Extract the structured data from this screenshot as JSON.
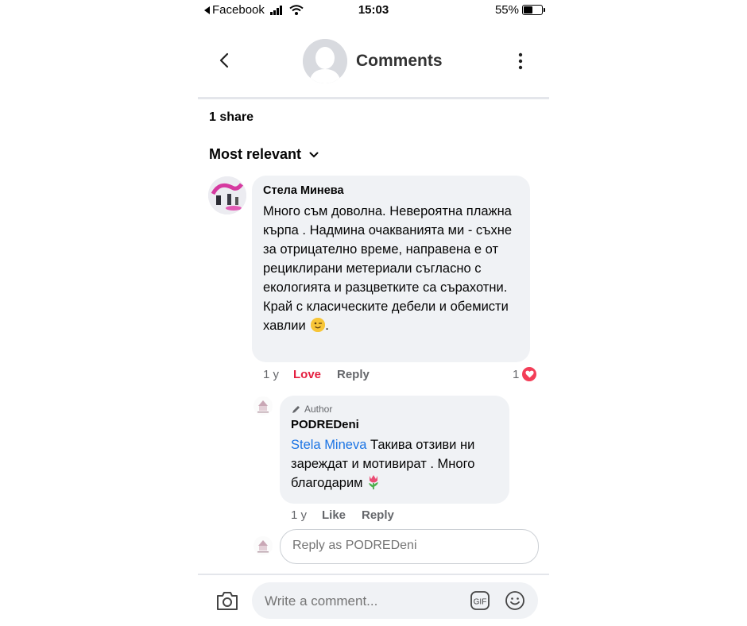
{
  "status_bar": {
    "back_app": "Facebook",
    "time": "15:03",
    "battery_percent": "55%",
    "battery_level": 0.55
  },
  "header": {
    "title": "Comments"
  },
  "post": {
    "shares": "1 share",
    "sort_label": "Most relevant"
  },
  "comment": {
    "author": "Стела Минева",
    "text": "Много съм доволна. Невероятна плажна кърпа . Надмина очакванията ми - съхне за отрицателно време, направена е от рециклирани метериали съгласно с екологията и разцветките са сърахотни. Край с класическите дебели и обемисти хавлии",
    "text_end": ".",
    "time": "1 y",
    "love_label": "Love",
    "reply_label": "Reply",
    "reaction_count": "1"
  },
  "reply": {
    "badge": "Author",
    "author": "PODREDeni",
    "mention": "Stela Mineva",
    "text": " Такива отзиви ни зареждат и мотивират . Много благодарим",
    "time": "1 y",
    "like_label": "Like",
    "reply_label": "Reply"
  },
  "reply_input": {
    "placeholder": "Reply as PODREDeni"
  },
  "composer": {
    "placeholder": "Write a comment...",
    "gif_label": "GIF"
  },
  "colors": {
    "accent": "#1b74e4",
    "love": "#e41e3f",
    "bubble": "#f0f2f5"
  }
}
